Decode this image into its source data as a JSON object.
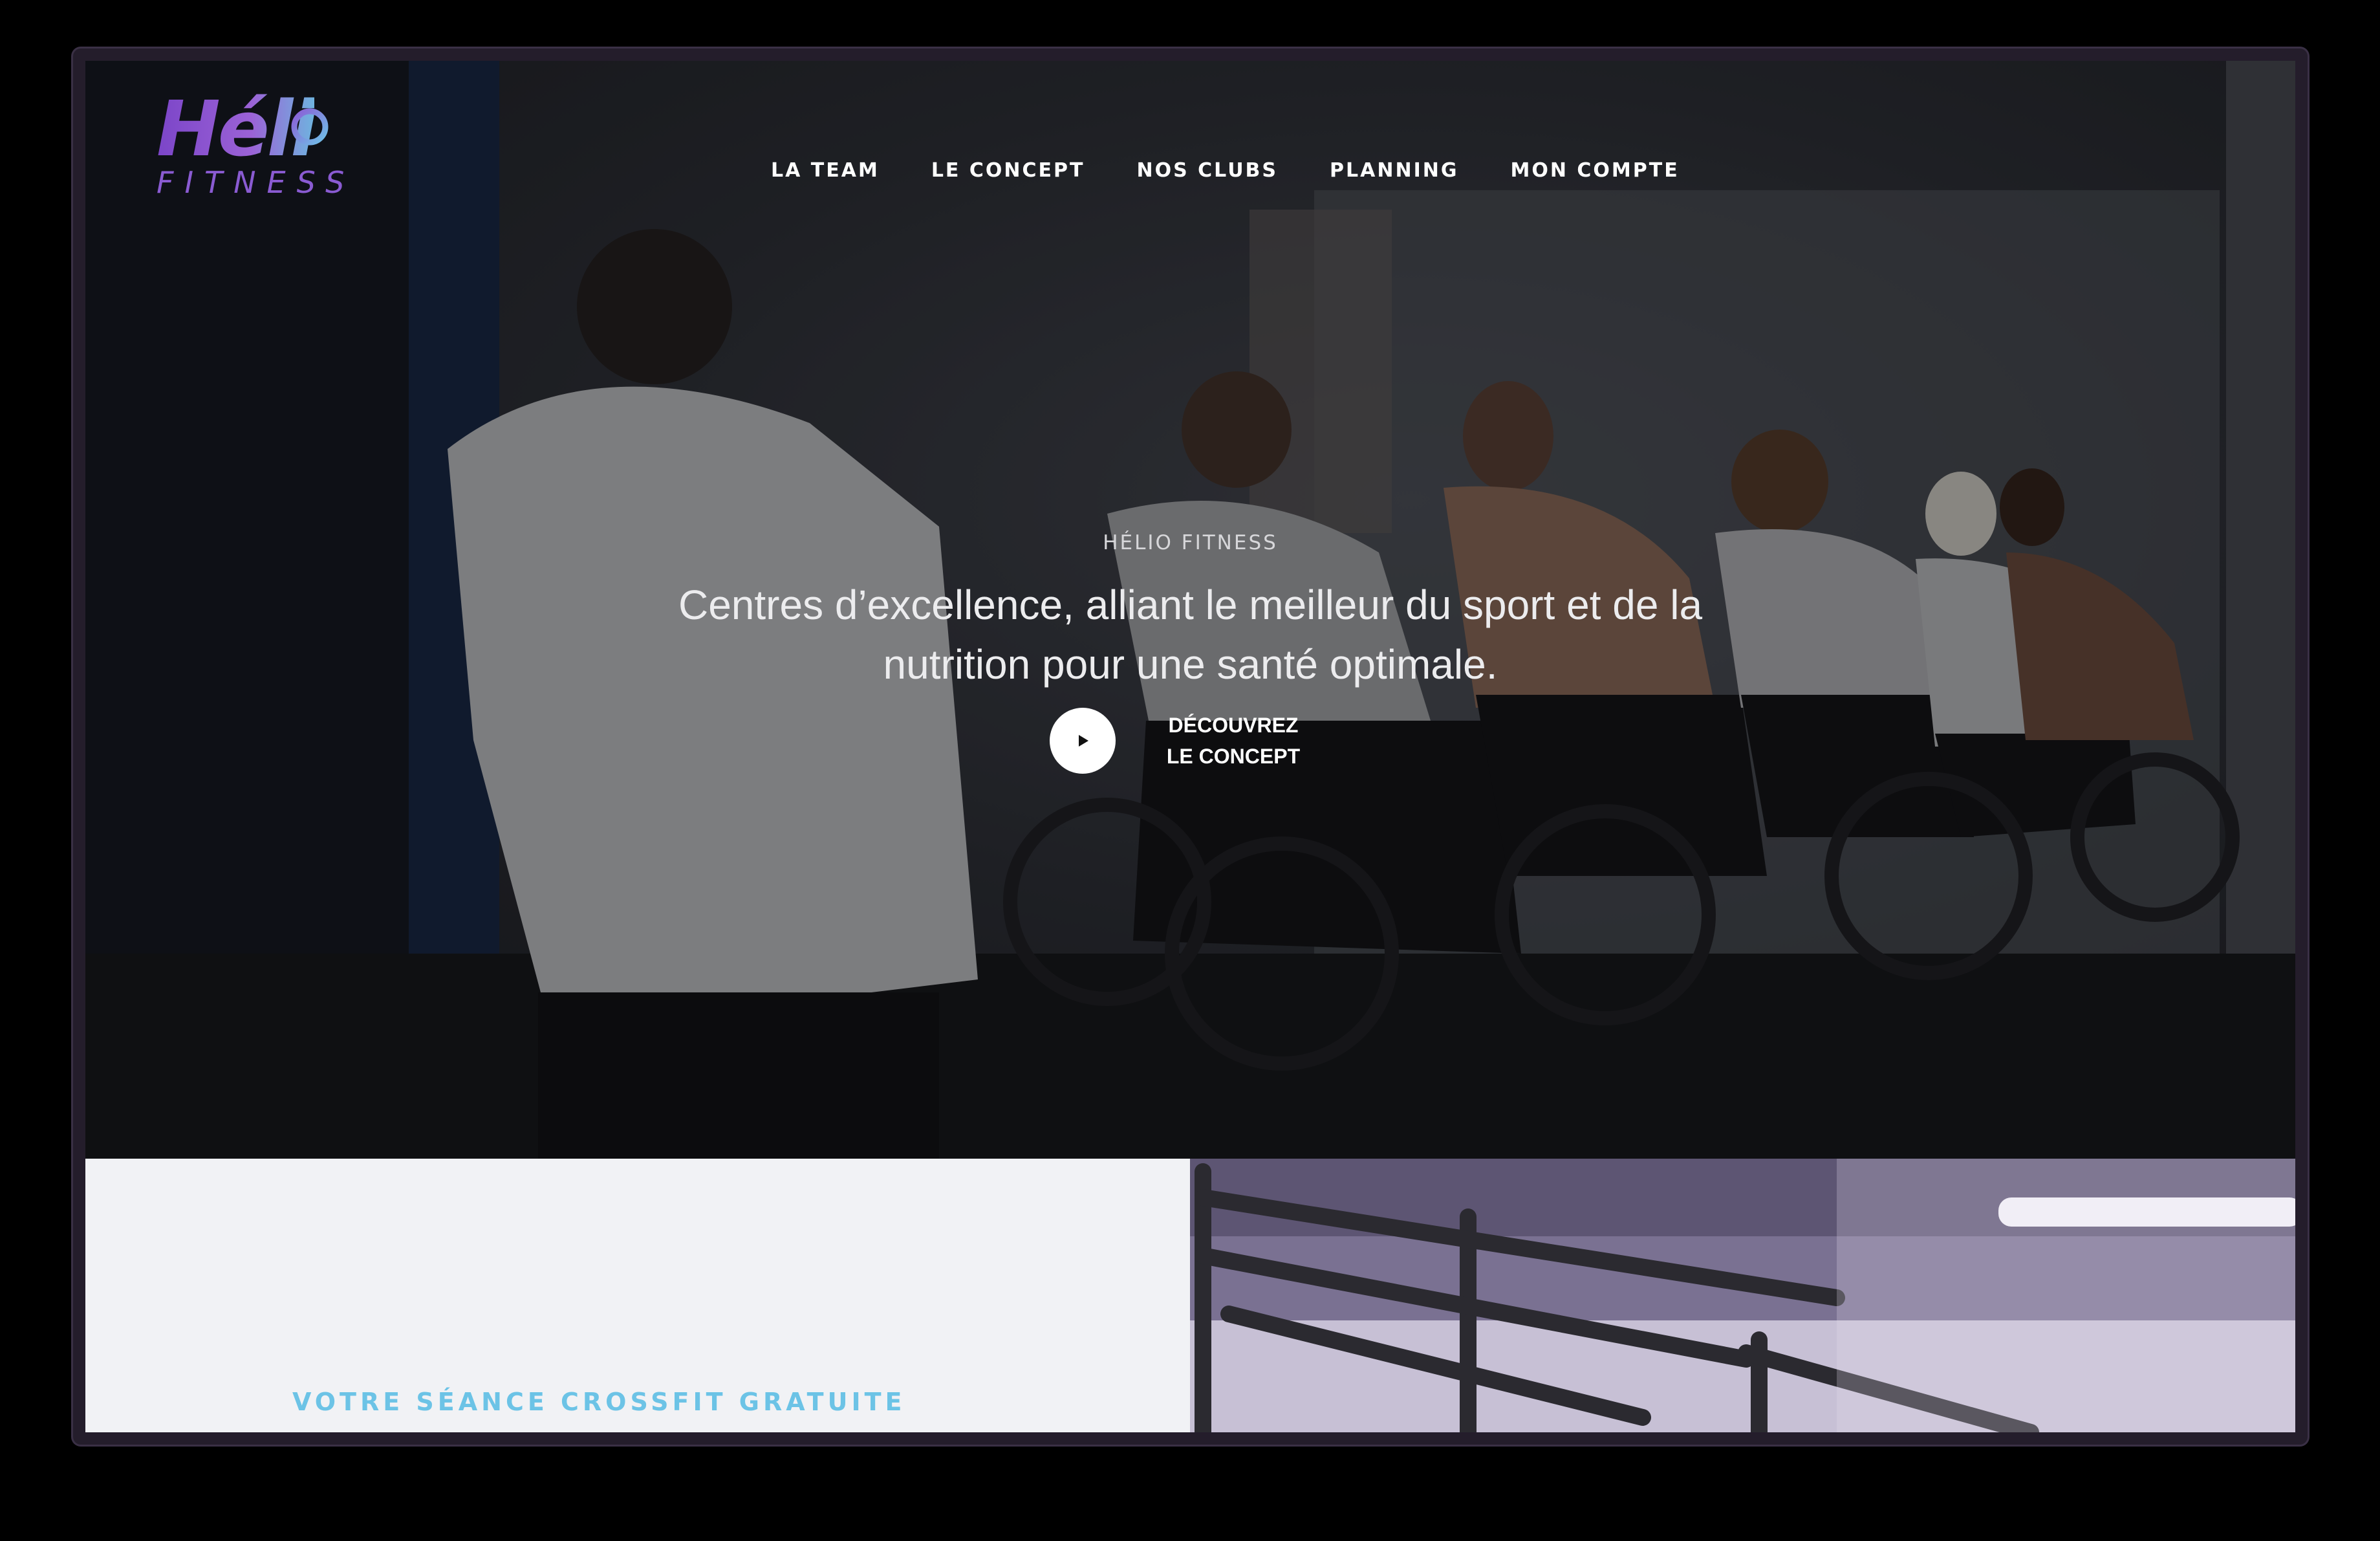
{
  "brand": {
    "logo_main": "Héli",
    "logo_sub": "FITNESS",
    "colors": {
      "purple": "#7b45c8",
      "blue": "#6fb3df"
    }
  },
  "nav": {
    "items": [
      {
        "label": "LA TEAM"
      },
      {
        "label": "LE CONCEPT"
      },
      {
        "label": "NOS CLUBS"
      },
      {
        "label": "PLANNING"
      },
      {
        "label": "MON COMPTE"
      }
    ]
  },
  "hero": {
    "eyebrow": "HÉLIO FITNESS",
    "headline": "Centres d’excellence, alliant le meilleur du sport et de la nutrition pour une santé optimale.",
    "cta_label": "DÉCOUVREZ LE CONCEPT",
    "cta_icon": "play-icon"
  },
  "section": {
    "crossfit_title": "VOTRE SÉANCE CROSSFIT GRATUITE",
    "accent_color": "#6cc3e6"
  }
}
